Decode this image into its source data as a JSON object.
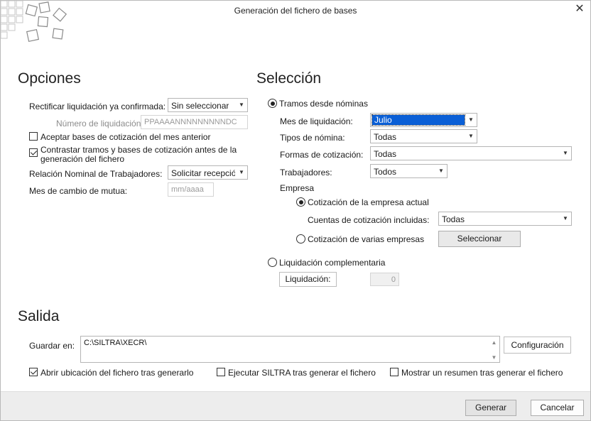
{
  "window": {
    "title": "Generación del fichero de bases"
  },
  "opciones": {
    "title": "Opciones",
    "rectificar_label": "Rectificar liquidación ya confirmada:",
    "rectificar_value": "Sin seleccionar",
    "numero_label": "Número de liquidación:",
    "numero_placeholder": "PPAAAANNNNNNNNNDC",
    "aceptar_bases_label": "Aceptar bases de cotización del mes anterior",
    "aceptar_bases_checked": false,
    "contrastar_label_1": "Contrastar tramos y bases de cotización antes de la",
    "contrastar_label_2": "generación del fichero",
    "contrastar_checked": true,
    "relacion_label": "Relación Nominal de Trabajadores:",
    "relacion_value": "Solicitar recepció",
    "mes_cambio_label": "Mes de cambio de mutua:",
    "mes_cambio_placeholder": "mm/aaaa"
  },
  "seleccion": {
    "title": "Selección",
    "tramos_label": "Tramos desde nóminas",
    "tramos_selected": true,
    "mes_liq_label": "Mes de liquidación:",
    "mes_liq_value": "Julio",
    "tipos_label": "Tipos de nómina:",
    "tipos_value": "Todas",
    "formas_label": "Formas de cotización:",
    "formas_value": "Todas",
    "trabajadores_label": "Trabajadores:",
    "trabajadores_value": "Todos",
    "empresa_label": "Empresa",
    "cot_actual_label": "Cotización de la empresa actual",
    "cot_actual_selected": true,
    "cuentas_label": "Cuentas de cotización incluidas:",
    "cuentas_value": "Todas",
    "cot_varias_label": "Cotización de varias empresas",
    "seleccionar_button": "Seleccionar",
    "complementaria_label": "Liquidación complementaria",
    "liquidacion_button": "Liquidación:",
    "liquidacion_value": "0"
  },
  "salida": {
    "title": "Salida",
    "guardar_label": "Guardar en:",
    "guardar_value": "C:\\SILTRA\\XECR\\",
    "configuracion_button": "Configuración",
    "abrir_label": "Abrir ubicación del fichero tras generarlo",
    "abrir_checked": true,
    "ejecutar_label": "Ejecutar SILTRA tras generar el fichero",
    "ejecutar_checked": false,
    "resumen_label": "Mostrar un resumen tras generar el fichero",
    "resumen_checked": false
  },
  "footer": {
    "generar_button": "Generar",
    "cancelar_button": "Cancelar"
  },
  "icons": {
    "logo": "tiled-squares-logo",
    "close": "close-icon",
    "dropdown": "chevron-down-icon"
  }
}
